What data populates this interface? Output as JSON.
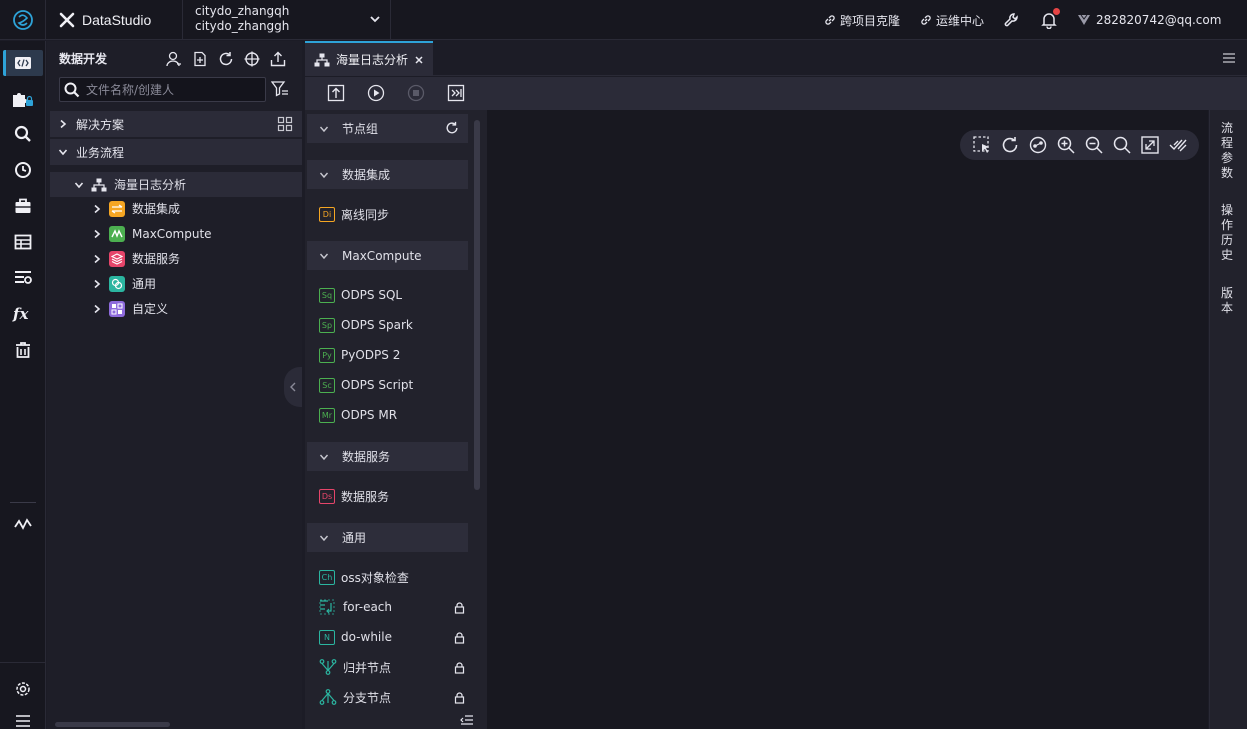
{
  "app": {
    "brand": "DataStudio"
  },
  "workspace": {
    "line1": "citydo_zhangqh",
    "line2": "citydo_zhanggh"
  },
  "topnav": {
    "cross_project_clone": "跨项目克隆",
    "ops_center": "运维中心",
    "user_email": "282820742@qq.com"
  },
  "explorer": {
    "title": "数据开发",
    "search_placeholder": "文件名称/创建人",
    "groups": [
      {
        "label": "解决方案"
      },
      {
        "label": "业务流程"
      }
    ],
    "tree": {
      "root": "海量日志分析",
      "children": [
        {
          "label": "数据集成",
          "icon": "data-integration-icon",
          "color": "#f5a623"
        },
        {
          "label": "MaxCompute",
          "icon": "maxcompute-icon",
          "color": "#4caf50"
        },
        {
          "label": "数据服务",
          "icon": "data-service-icon",
          "color": "#e6456a"
        },
        {
          "label": "通用",
          "icon": "general-icon",
          "color": "#2bb5a0"
        },
        {
          "label": "自定义",
          "icon": "custom-icon",
          "color": "#8e6bdc"
        }
      ]
    }
  },
  "editor": {
    "tab_label": "海量日志分析"
  },
  "palette": {
    "node_group": "节点组",
    "sections": [
      {
        "title": "数据集成",
        "items": [
          {
            "badge": "Di",
            "label": "离线同步",
            "color": "#f5a623"
          }
        ]
      },
      {
        "title": "MaxCompute",
        "items": [
          {
            "badge": "Sq",
            "label": "ODPS SQL",
            "color": "#4caf50"
          },
          {
            "badge": "Sp",
            "label": "ODPS Spark",
            "color": "#4caf50"
          },
          {
            "badge": "Py",
            "label": "PyODPS 2",
            "color": "#4caf50"
          },
          {
            "badge": "Sc",
            "label": "ODPS Script",
            "color": "#4caf50"
          },
          {
            "badge": "Mr",
            "label": "ODPS MR",
            "color": "#4caf50"
          }
        ]
      },
      {
        "title": "数据服务",
        "items": [
          {
            "badge": "Ds",
            "label": "数据服务",
            "color": "#e6456a"
          }
        ]
      },
      {
        "title": "通用",
        "items": [
          {
            "badge": "Ch",
            "label": "oss对象检查",
            "color": "#2bb5a0"
          },
          {
            "badge": "",
            "label": "for-each",
            "color": "#2bb5a0",
            "icon": "for-each-icon",
            "locked": true
          },
          {
            "badge": "N",
            "label": "do-while",
            "color": "#2bb5a0",
            "locked": true
          },
          {
            "badge": "",
            "label": "归并节点",
            "color": "#2bb5a0",
            "icon": "merge-node-icon",
            "locked": true
          },
          {
            "badge": "",
            "label": "分支节点",
            "color": "#2bb5a0",
            "icon": "branch-node-icon",
            "locked": true
          }
        ]
      }
    ]
  },
  "right_panel": {
    "flow_params": "流程参数",
    "history": "操作历史",
    "versions": "版本"
  },
  "colors": {
    "accent": "#2ea3d8",
    "notification": "#e64545"
  }
}
